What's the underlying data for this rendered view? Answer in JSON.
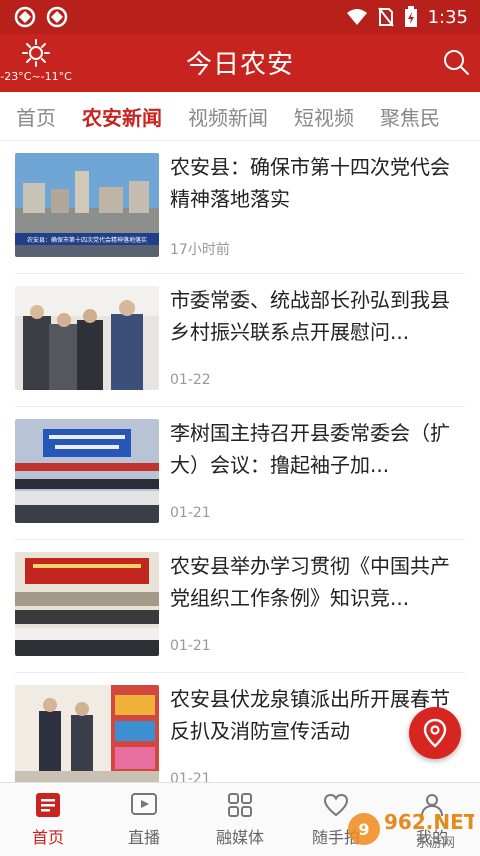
{
  "status_bar": {
    "time": "1:35"
  },
  "header": {
    "title": "今日农安",
    "weather": "-23°C~-11°C",
    "icons": {
      "weather": "sun-icon",
      "search": "search-icon"
    }
  },
  "tabs": [
    "首页",
    "农安新闻",
    "视频新闻",
    "短视频",
    "聚焦民"
  ],
  "news": [
    {
      "title": "农安县：确保市第十四次党代会精神落地落实",
      "time": "17小时前",
      "thumb_caption": "农安县：确保市第十四次党代会精神落地落实"
    },
    {
      "title": "市委常委、统战部长孙弘到我县乡村振兴联系点开展慰问...",
      "time": "01-22"
    },
    {
      "title": "李树国主持召开县委常委会（扩大）会议：撸起袖子加...",
      "time": "01-21"
    },
    {
      "title": "农安县举办学习贯彻《中国共产党组织工作条例》知识竞...",
      "time": "01-21"
    },
    {
      "title": "农安县伏龙泉镇派出所开展春节反扒及消防宣传活动",
      "time": "01-21"
    }
  ],
  "bottom_nav": [
    "首页",
    "直播",
    "融媒体",
    "随手拍",
    "我的"
  ],
  "watermark": {
    "text": "962.NET",
    "subtext": "乐游网"
  },
  "colors": {
    "brand_red": "#c8241f",
    "statusbar_red": "#b8201c"
  }
}
